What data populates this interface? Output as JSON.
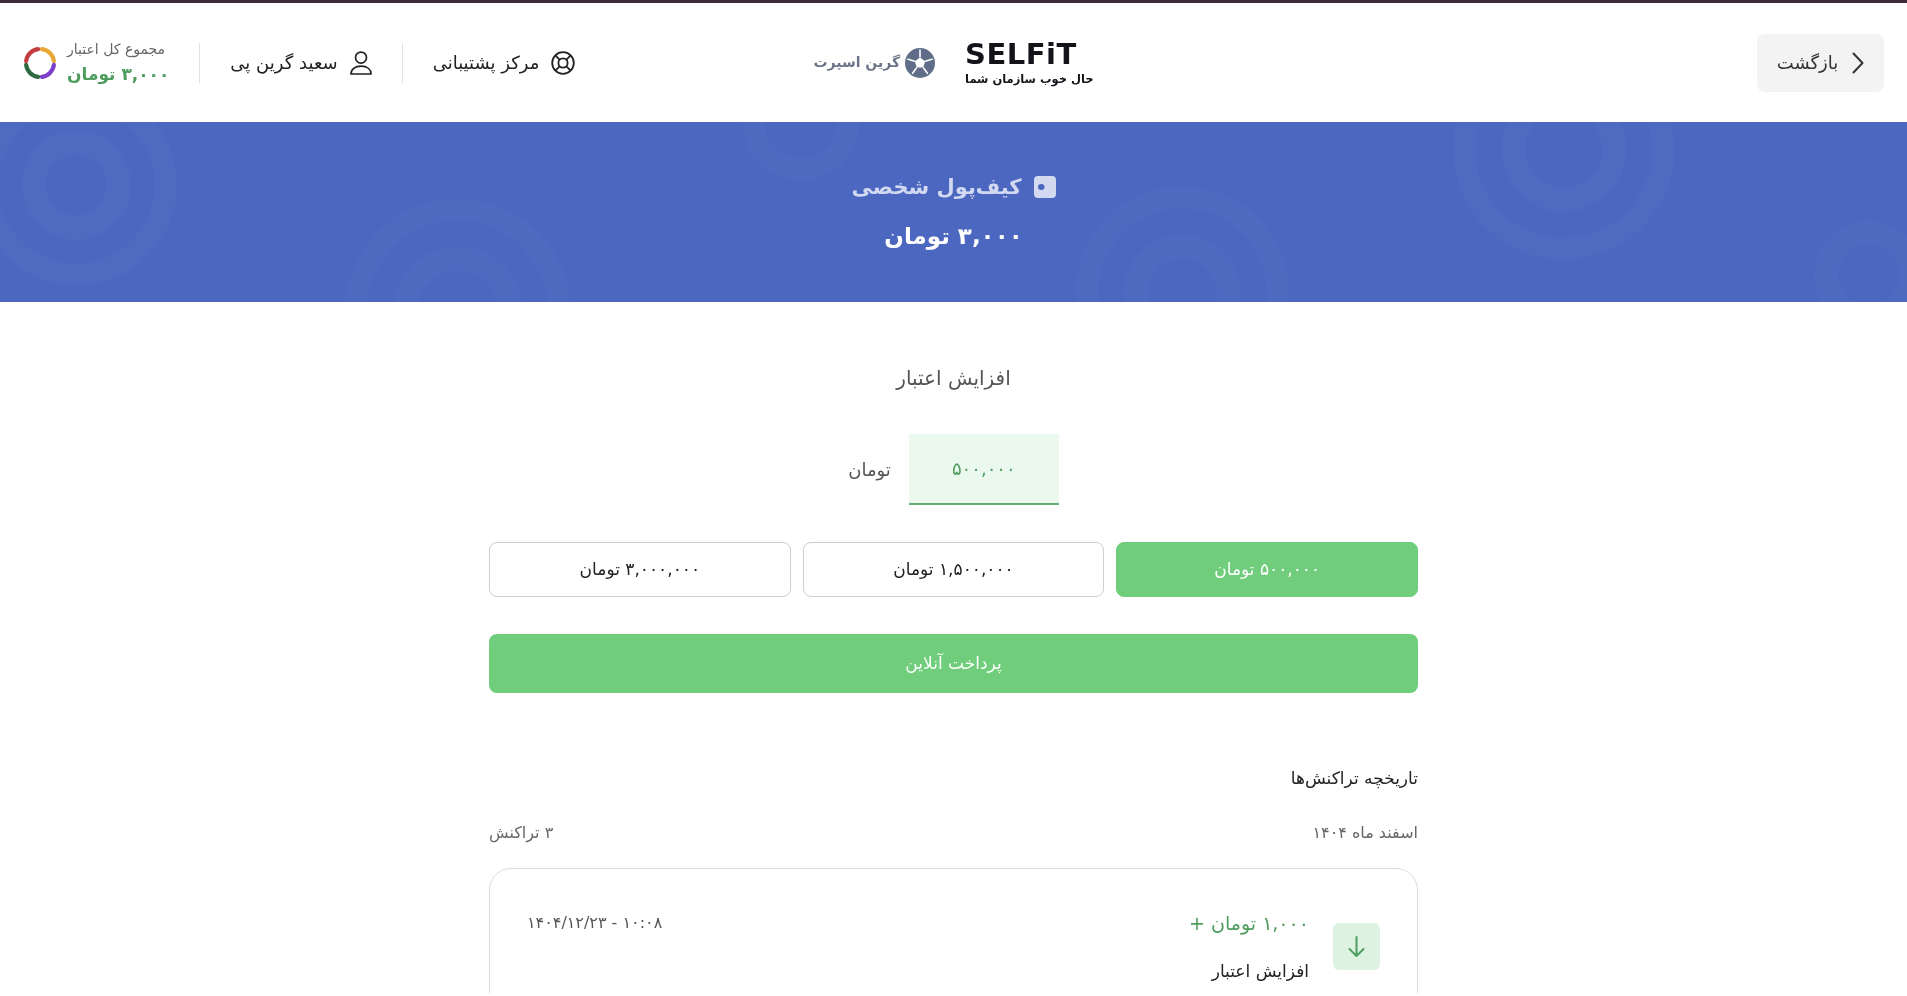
{
  "header": {
    "back_button": {
      "label": "بازگشت"
    },
    "logo": {
      "wordmark": "SELFiT",
      "tagline": "حال خوب سازمان شما"
    },
    "partner_logo": {
      "label": "گرین اسپرت"
    },
    "support_link": {
      "label": "مرکز پشتیبانی"
    },
    "user": {
      "name": "سعید گرین پی"
    },
    "credit_total": {
      "label": "مجموع کل اعتبار",
      "amount": "۳,۰۰۰ تومان"
    }
  },
  "wallet_banner": {
    "title": "کیف‌پول شخصی",
    "balance": "۳,۰۰۰ تومان"
  },
  "top_up": {
    "title": "افزایش اعتبار",
    "amount_field": {
      "value": "۵۰۰,۰۰۰",
      "unit": "تومان"
    },
    "presets": [
      {
        "label": "۵۰۰,۰۰۰ تومان",
        "selected": true
      },
      {
        "label": "۱,۵۰۰,۰۰۰ تومان",
        "selected": false
      },
      {
        "label": "۳,۰۰۰,۰۰۰ تومان",
        "selected": false
      }
    ],
    "pay_button": {
      "label": "پرداخت آنلاین"
    }
  },
  "history": {
    "title": "تاریخچه تراکنش‌ها",
    "groups": [
      {
        "month": "اسفند ماه ۱۴۰۴",
        "count": "۳ تراکنش",
        "transactions": [
          {
            "amount": "۱,۰۰۰ تومان +",
            "title": "افزایش اعتبار",
            "datetime": "۱۰:۰۸ - ۱۴۰۴/۱۲/۲۳"
          }
        ]
      }
    ]
  }
}
